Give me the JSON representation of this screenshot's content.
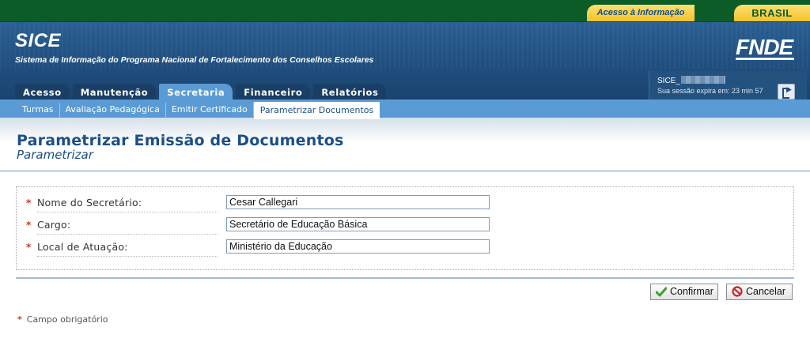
{
  "gov_bar": {
    "access_info": "Acesso à Informação",
    "brasil_logo": "BRASIL"
  },
  "header": {
    "app_title": "SICE",
    "app_subtitle": "Sistema de Informação do Programa Nacional de Fortalecimento dos Conselhos Escolares",
    "org_logo": "FNDE"
  },
  "main_tabs": [
    {
      "label": "Acesso"
    },
    {
      "label": "Manutenção"
    },
    {
      "label": "Secretaria",
      "active": true
    },
    {
      "label": "Financeiro"
    },
    {
      "label": "Relatórios"
    }
  ],
  "session": {
    "user_prefix": "SICE_",
    "expires": "Sua sessão expira em: 23 min 57"
  },
  "sub_tabs": [
    {
      "label": "Turmas"
    },
    {
      "label": "Avaliação Pedagógica"
    },
    {
      "label": "Emitir Certificado"
    },
    {
      "label": "Parametrizar Documentos",
      "active": true
    }
  ],
  "page": {
    "title": "Parametrizar Emissão de Documentos",
    "subtitle": "Parametrizar"
  },
  "form": {
    "required_mark": "*",
    "fields": [
      {
        "label": "Nome do Secretário:",
        "value": "Cesar Callegari"
      },
      {
        "label": "Cargo:",
        "value": "Secretário de Educação Básica"
      },
      {
        "label": "Local de Atuação:",
        "value": "Ministério da Educação"
      }
    ],
    "confirm_label": "Confirmar",
    "cancel_label": "Cancelar",
    "required_note": "Campo obrigatório"
  },
  "colors": {
    "gov_green": "#0c5c27",
    "header_blue": "#1f4d7d",
    "active_tab": "#5b9bd5",
    "title_blue": "#1b4f86",
    "required_red": "#c0392b"
  }
}
